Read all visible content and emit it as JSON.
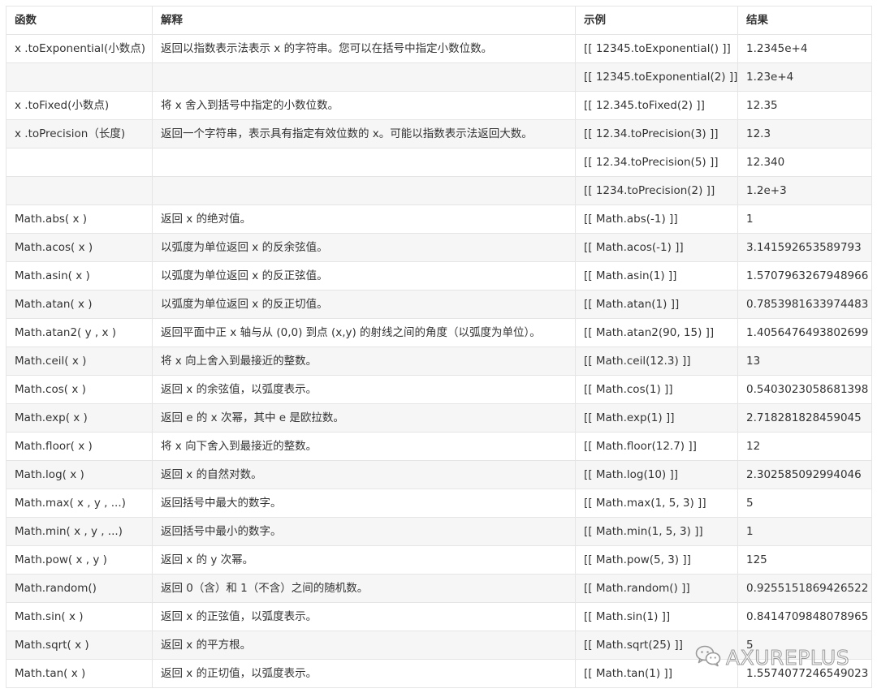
{
  "headers": [
    "函数",
    "解释",
    "示例",
    "结果"
  ],
  "rows": [
    [
      "x .toExponential(小数点)",
      "返回以指数表示法表示 x 的字符串。您可以在括号中指定小数位数。",
      "[[ 12345.toExponential() ]]",
      "1.2345e+4"
    ],
    [
      "",
      "",
      "[[ 12345.toExponential(2) ]]",
      "1.23e+4"
    ],
    [
      "x .toFixed(小数点)",
      "将 x 舍入到括号中指定的小数位数。",
      "[[ 12.345.toFixed(2) ]]",
      "12.35"
    ],
    [
      "x .toPrecision（长度)",
      "返回一个字符串，表示具有指定有效位数的 x。可能以指数表示法返回大数。",
      "[[ 12.34.toPrecision(3) ]]",
      "12.3"
    ],
    [
      "",
      "",
      "[[ 12.34.toPrecision(5) ]]",
      "12.340"
    ],
    [
      "",
      "",
      "[[ 1234.toPrecision(2) ]]",
      "1.2e+3"
    ],
    [
      "Math.abs( x )",
      "返回 x 的绝对值。",
      "[[ Math.abs(-1) ]]",
      "1"
    ],
    [
      "Math.acos( x )",
      "以弧度为单位返回 x 的反余弦值。",
      "[[ Math.acos(-1) ]]",
      "3.141592653589793"
    ],
    [
      "Math.asin( x )",
      "以弧度为单位返回 x 的反正弦值。",
      "[[ Math.asin(1) ]]",
      "1.5707963267948966"
    ],
    [
      "Math.atan( x )",
      "以弧度为单位返回 x 的反正切值。",
      "[[ Math.atan(1) ]]",
      "0.7853981633974483"
    ],
    [
      "Math.atan2( y , x )",
      "返回平面中正 x 轴与从 (0,0) 到点 (x,y) 的射线之间的角度（以弧度为单位）。",
      "[[ Math.atan2(90, 15) ]]",
      "1.4056476493802699"
    ],
    [
      "Math.ceil( x )",
      "将 x 向上舍入到最接近的整数。",
      "[[ Math.ceil(12.3) ]]",
      "13"
    ],
    [
      "Math.cos( x )",
      "返回 x 的余弦值，以弧度表示。",
      "[[ Math.cos(1) ]]",
      "0.5403023058681398"
    ],
    [
      "Math.exp( x )",
      "返回 e 的 x 次幂，其中 e 是欧拉数。",
      "[[ Math.exp(1) ]]",
      "2.718281828459045"
    ],
    [
      "Math.floor( x )",
      "将 x 向下舍入到最接近的整数。",
      "[[ Math.floor(12.7) ]]",
      "12"
    ],
    [
      "Math.log( x )",
      "返回 x 的自然对数。",
      "[[ Math.log(10) ]]",
      "2.302585092994046"
    ],
    [
      "Math.max( x , y , ...)",
      "返回括号中最大的数字。",
      "[[ Math.max(1, 5, 3) ]]",
      "5"
    ],
    [
      "Math.min( x , y , ...)",
      "返回括号中最小的数字。",
      "[[ Math.min(1, 5, 3) ]]",
      "1"
    ],
    [
      "Math.pow( x , y )",
      "返回 x 的 y 次幂。",
      "[[ Math.pow(5, 3) ]]",
      "125"
    ],
    [
      "Math.random()",
      "返回 0（含）和 1（不含）之间的随机数。",
      "[[ Math.random() ]]",
      "0.9255151869426522"
    ],
    [
      "Math.sin( x )",
      "返回 x 的正弦值，以弧度表示。",
      "[[ Math.sin(1) ]]",
      "0.8414709848078965"
    ],
    [
      "Math.sqrt( x )",
      "返回 x 的平方根。",
      "[[ Math.sqrt(25) ]]",
      "5"
    ],
    [
      "Math.tan( x )",
      "返回 x 的正切值，以弧度表示。",
      "[[ Math.tan(1) ]]",
      "1.5574077246549023"
    ]
  ],
  "watermark": {
    "text": "AXUREPLUS",
    "icon": "wechat-icon"
  }
}
